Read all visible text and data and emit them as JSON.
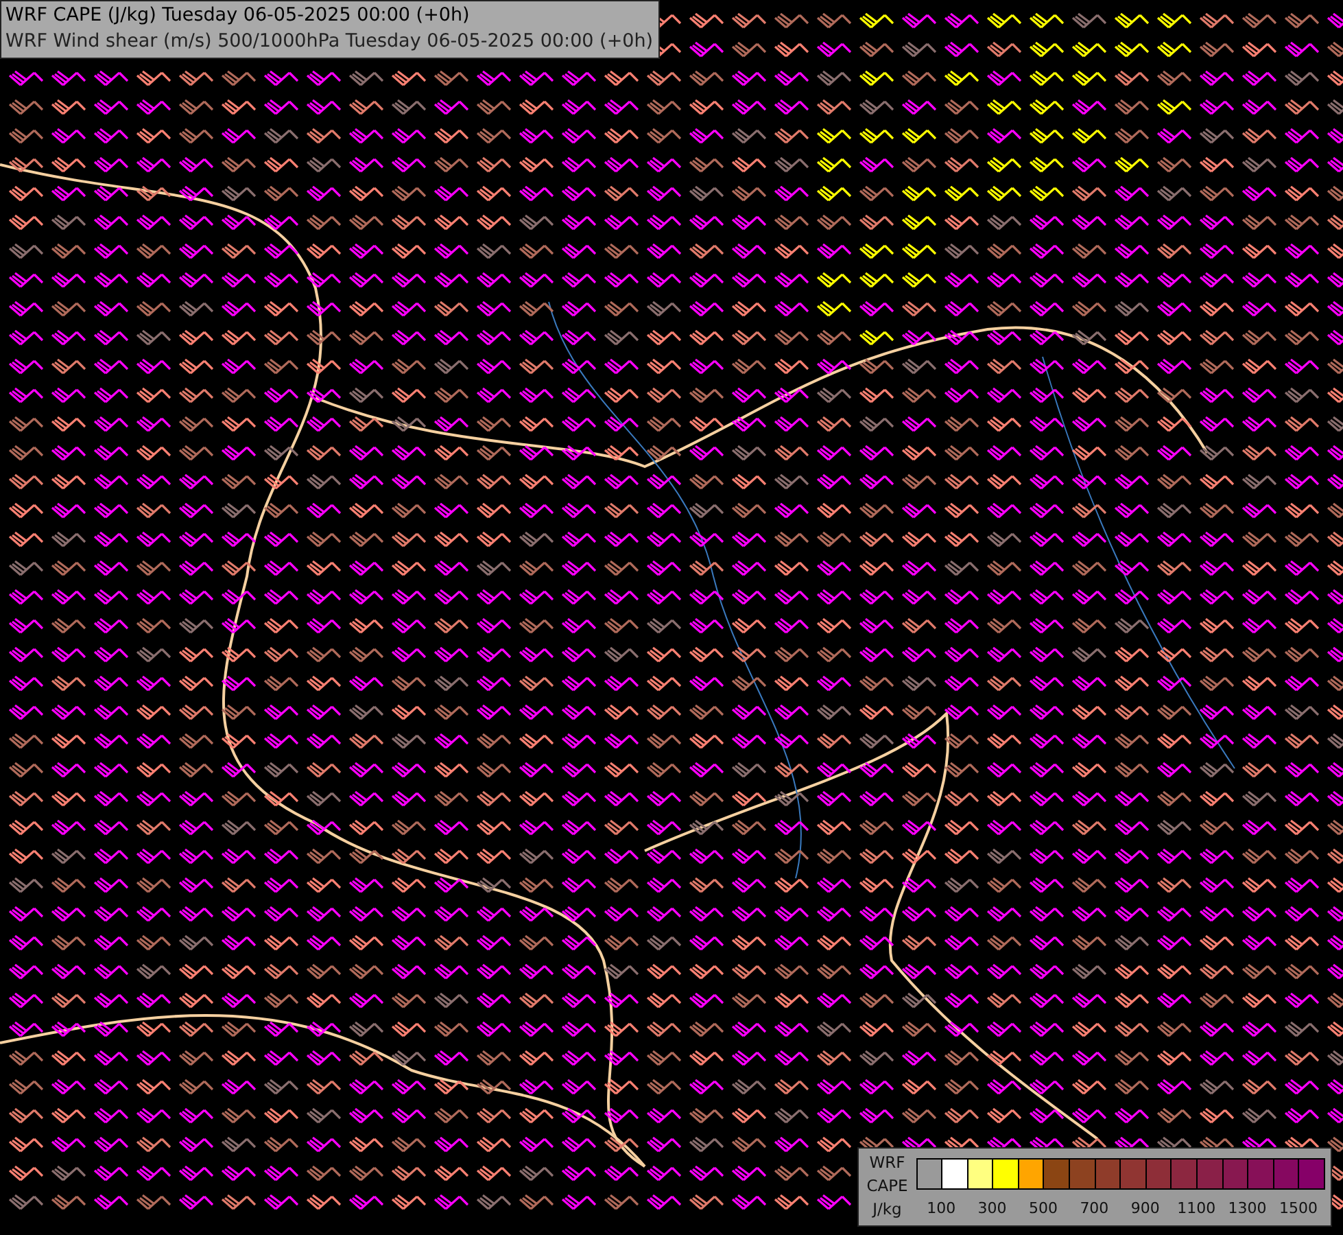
{
  "title_lines": [
    "WRF CAPE (J/kg) Tuesday 06-05-2025 00:00 (+0h)",
    "WRF Wind shear (m/s) 500/1000hPa Tuesday 06-05-2025 00:00 (+0h)"
  ],
  "legend": {
    "label_lines": [
      "WRF",
      "CAPE",
      "J/kg"
    ],
    "swatches": [
      {
        "color": "#9a9a9a"
      },
      {
        "color": "#ffffff"
      },
      {
        "color": "#ffff80"
      },
      {
        "color": "#ffff00"
      },
      {
        "color": "#ffa500"
      },
      {
        "color": "#8b4513"
      },
      {
        "color": "#8d4220"
      },
      {
        "color": "#8f3c2a"
      },
      {
        "color": "#903532"
      },
      {
        "color": "#8e2e38"
      },
      {
        "color": "#8c2740"
      },
      {
        "color": "#8a2048"
      },
      {
        "color": "#881850"
      },
      {
        "color": "#871058"
      },
      {
        "color": "#860860"
      },
      {
        "color": "#860068"
      }
    ],
    "ticks": [
      "100",
      "300",
      "500",
      "700",
      "900",
      "1100",
      "1300",
      "1500"
    ]
  }
}
